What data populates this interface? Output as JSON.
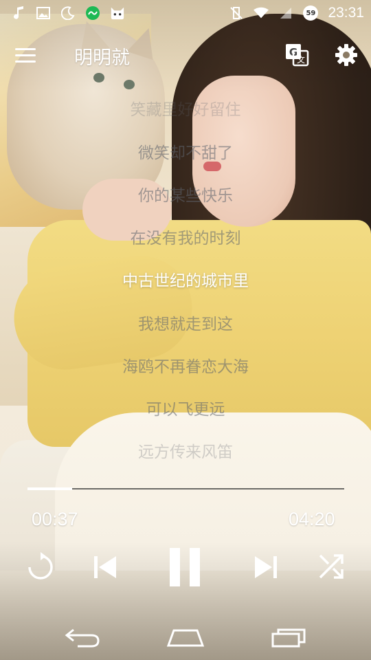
{
  "status_bar": {
    "time": "23:31",
    "battery_badge": "59"
  },
  "toolbar": {
    "title": "明明就"
  },
  "lyrics": {
    "lines": [
      "笑藏里好好留住",
      "微笑却不甜了",
      "你的某些快乐",
      "在没有我的时刻",
      "中古世纪的城市里",
      "我想就走到这",
      "海鸥不再眷恋大海",
      "可以飞更远",
      "远方传来风笛"
    ],
    "current_index": 4
  },
  "player": {
    "elapsed": "00:37",
    "total": "04:20",
    "progress_fraction": 0.14
  }
}
